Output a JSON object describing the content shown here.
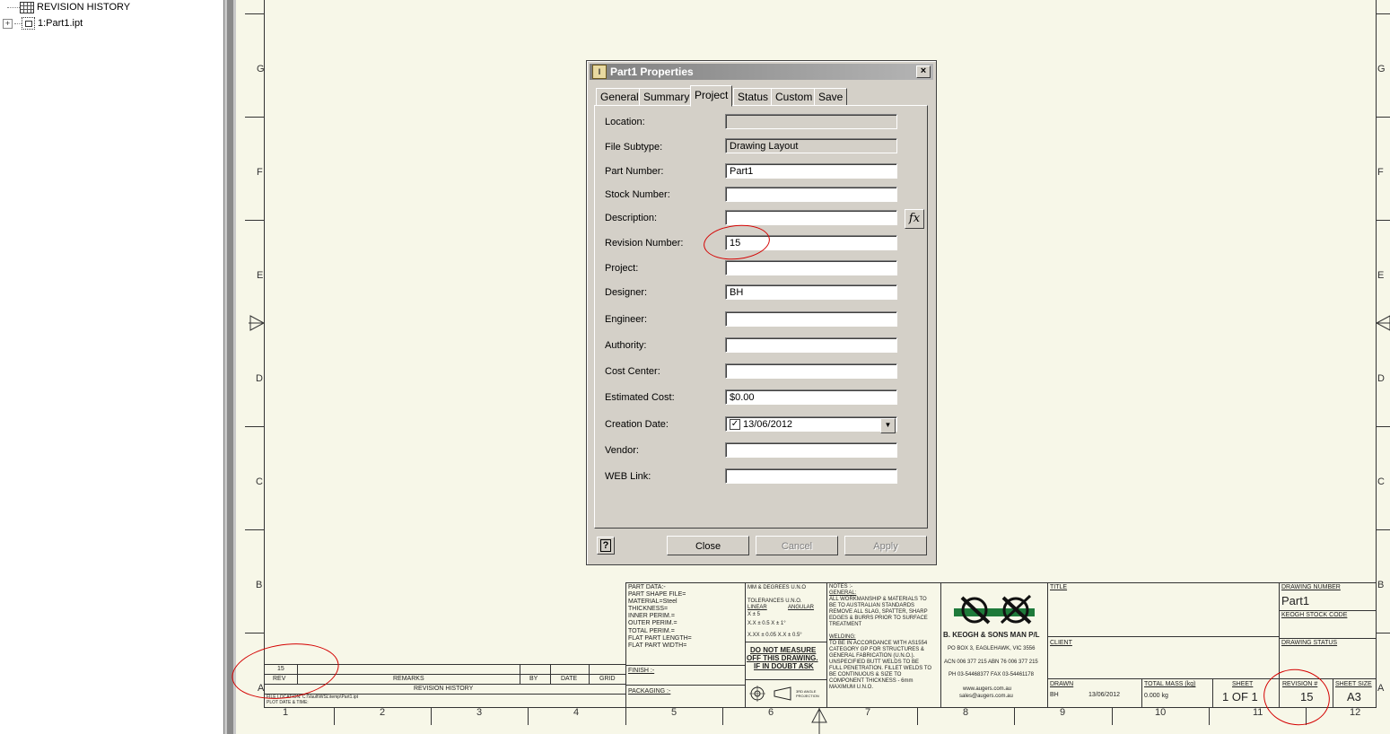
{
  "tree": {
    "items": [
      {
        "label": "REVISION HISTORY",
        "icon": "table-icon"
      },
      {
        "label": "1:Part1.ipt",
        "icon": "part-icon"
      }
    ]
  },
  "sheet": {
    "zone_letters": [
      "G",
      "F",
      "E",
      "D",
      "C",
      "B",
      "A"
    ],
    "zone_numbers": [
      "1",
      "2",
      "3",
      "4",
      "5",
      "6",
      "7",
      "8",
      "9",
      "10",
      "11",
      "12"
    ],
    "revision_table": {
      "rev_value": "15",
      "headers": [
        "REV",
        "REMARKS",
        "BY",
        "DATE",
        "GRID"
      ],
      "caption": "REVISION HISTORY",
      "file_location": "FILE LOCATION:   C:\\Vault\\WSL\\temp\\Part1.ipt",
      "plot_date": "PLOT DATE & TIME:"
    },
    "part_data": {
      "lines": [
        "PART DATA:-",
        "PART SHAPE FILE=",
        "MATERIAL=Steel",
        "THICKNESS=",
        "INNER PERIM.=",
        "OUTER PERIM.=",
        "TOTAL PERIM.=",
        "FLAT PART LENGTH=",
        "FLAT PART WIDTH="
      ],
      "finish": "FINISH :-",
      "packaging": "PACKAGING :-"
    },
    "tolerances": {
      "units": "MM & DEGREES U.N.O",
      "title": "TOLERANCES U.N.O.",
      "linear": "LINEAR",
      "angular": "ANGULAR",
      "rows": [
        "X ± 5",
        "X.X ± 0.5     X ± 1°",
        "X.XX ± 0.05    X.X ± 0.5°"
      ],
      "warning": [
        "DO NOT MEASURE",
        "OFF THIS DRAWING.",
        "IF IN DOUBT ASK"
      ],
      "projection": "3RD ANGLE PROJECTION"
    },
    "notes": {
      "header": "NOTES :-",
      "general_title": "GENERAL:",
      "general": [
        "ALL WORKMANSHIP & MATERIALS TO",
        "BE TO AUSTRALIAN STANDARDS",
        "REMOVE ALL SLAG, SPATTER, SHARP",
        "EDGES & BURRS PRIOR TO SURFACE",
        "TREATMENT"
      ],
      "welding_title": "WELDING:",
      "welding": [
        "TO BE IN ACCORDANCE WITH AS1554",
        "CATEGORY GP FOR STRUCTURES &",
        "GENERAL FABRICATION (U.N.O.).",
        "UNSPECIFIED BUTT WELDS TO BE",
        "FULL PENETRATION. FILLET WELDS TO",
        "BE CONTINUOUS & SIZE TO",
        "COMPONENT THICKNESS - 6mm",
        "MAXIMUM U.N.O."
      ]
    },
    "company": {
      "name": "B. KEOGH & SONS MAN P/L",
      "address": "PO BOX 3, EAGLEHAWK, VIC 3556",
      "acn": "ACN 006 377 215 ABN 76 006 377 215",
      "phone": "PH 03-54468377 FAX 03-54461178",
      "web": "www.augers.com.au",
      "email": "sales@augers.com.au",
      "logo_colors": {
        "green": "#1e7a3a",
        "black": "#111111"
      }
    },
    "title_block": {
      "title_label": "TITLE",
      "client_label": "CLIENT",
      "drawn_label": "DRAWN",
      "drawn_by": "BH",
      "drawn_date": "13/06/2012",
      "mass_label": "TOTAL MASS (kg)",
      "mass_value": "0.000 kg",
      "sheet_label": "SHEET",
      "sheet_value": "1  OF  1",
      "drawing_number_label": "DRAWING NUMBER",
      "drawing_number": "Part1",
      "stock_code_label": "KEOGH STOCK CODE",
      "status_label": "DRAWING STATUS",
      "revision_label": "REVISION #",
      "revision_value": "15",
      "size_label": "SHEET SIZE",
      "size_value": "A3"
    }
  },
  "dialog": {
    "title": "Part1 Properties",
    "tabs": [
      "General",
      "Summary",
      "Project",
      "Status",
      "Custom",
      "Save"
    ],
    "active_tab": "Project",
    "fields": [
      {
        "label": "Location:",
        "value": "",
        "readonly": true
      },
      {
        "label": "File Subtype:",
        "value": "Drawing Layout",
        "readonly": true
      },
      {
        "label": "Part Number:",
        "value": "Part1"
      },
      {
        "label": "Stock Number:",
        "value": ""
      },
      {
        "label": "Description:",
        "value": ""
      },
      {
        "label": "Revision Number:",
        "value": "15"
      },
      {
        "label": "Project:",
        "value": ""
      },
      {
        "label": "Designer:",
        "value": "BH"
      },
      {
        "label": "Engineer:",
        "value": ""
      },
      {
        "label": "Authority:",
        "value": ""
      },
      {
        "label": "Cost Center:",
        "value": ""
      },
      {
        "label": "Estimated Cost:",
        "value": "$0.00"
      },
      {
        "label": "Creation Date:",
        "value": "13/06/2012",
        "checked": true
      },
      {
        "label": "Vendor:",
        "value": ""
      },
      {
        "label": "WEB Link:",
        "value": ""
      }
    ],
    "fx_label": "fx",
    "buttons": {
      "help": "?",
      "close": "Close",
      "cancel": "Cancel",
      "apply": "Apply"
    }
  },
  "annotation_color": "#d40000"
}
